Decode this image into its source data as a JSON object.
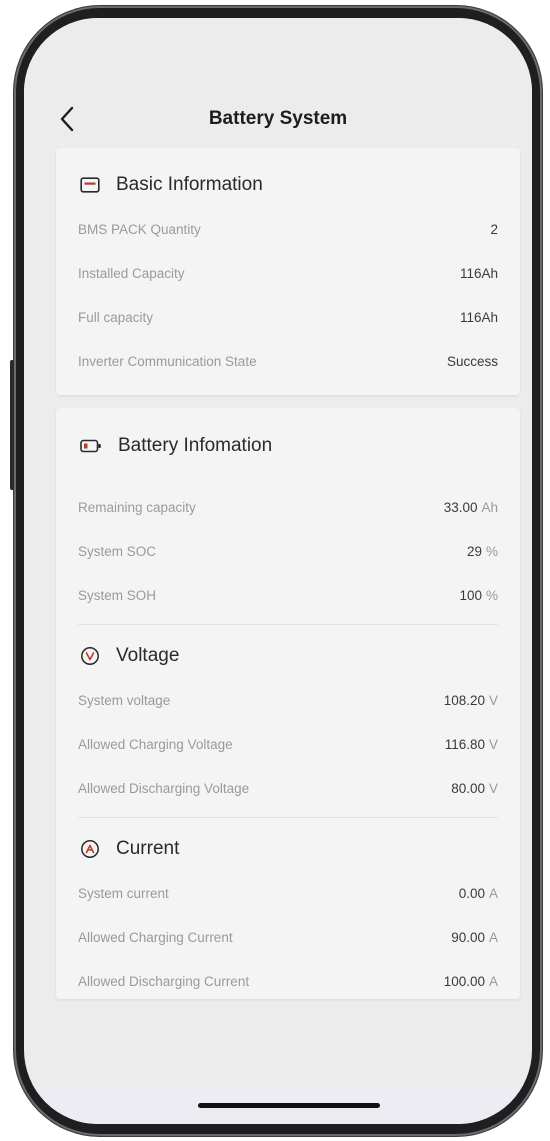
{
  "header": {
    "title": "Battery System",
    "back_icon": "chevron-left-icon"
  },
  "basic_info": {
    "title": "Basic Information",
    "icon": "info-card-icon",
    "rows": [
      {
        "label": "BMS PACK Quantity",
        "value": "2",
        "unit": ""
      },
      {
        "label": "Installed Capacity",
        "value": "116Ah",
        "unit": ""
      },
      {
        "label": "Full capacity",
        "value": "116Ah",
        "unit": ""
      },
      {
        "label": "Inverter Communication State",
        "value": "Success",
        "unit": ""
      }
    ]
  },
  "battery_info": {
    "title": "Battery Infomation",
    "icon": "battery-icon",
    "rows": [
      {
        "label": "Remaining capacity",
        "value": "33.00",
        "unit": "Ah"
      },
      {
        "label": "System SOC",
        "value": "29",
        "unit": "%"
      },
      {
        "label": "System SOH",
        "value": "100",
        "unit": "%"
      }
    ]
  },
  "voltage": {
    "title": "Voltage",
    "icon": "voltage-icon",
    "rows": [
      {
        "label": "System voltage",
        "value": "108.20",
        "unit": "V"
      },
      {
        "label": "Allowed Charging Voltage",
        "value": "116.80",
        "unit": "V"
      },
      {
        "label": "Allowed Discharging Voltage",
        "value": "80.00",
        "unit": "V"
      }
    ]
  },
  "current": {
    "title": "Current",
    "icon": "current-icon",
    "rows": [
      {
        "label": "System current",
        "value": "0.00",
        "unit": "A"
      },
      {
        "label": "Allowed Charging Current",
        "value": "90.00",
        "unit": "A"
      },
      {
        "label": "Allowed Discharging Current",
        "value": "100.00",
        "unit": "A"
      }
    ]
  },
  "colors": {
    "accent_red": "#c0392b",
    "background": "#ececec",
    "card": "#f4f4f4"
  }
}
